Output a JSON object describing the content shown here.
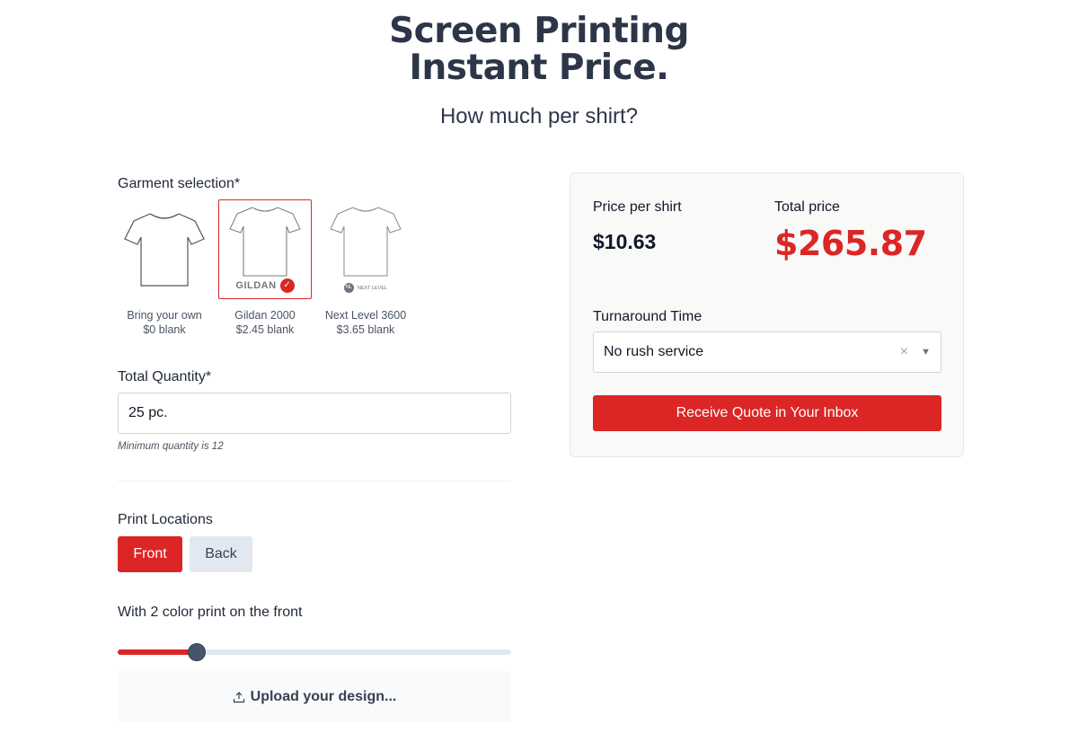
{
  "hero": {
    "title_line1": "Screen Printing",
    "title_line2": "Instant Price.",
    "subtitle": "How much per shirt?"
  },
  "garment": {
    "label": "Garment selection*",
    "options": [
      {
        "name": "Bring your own",
        "price": "$0 blank",
        "brand": "",
        "selected": false
      },
      {
        "name": "Gildan 2000",
        "price": "$2.45 blank",
        "brand": "GILDAN",
        "selected": true
      },
      {
        "name": "Next Level 3600",
        "price": "$3.65 blank",
        "brand": "NEXT LEVEL",
        "badge": "NL",
        "selected": false
      }
    ]
  },
  "quantity": {
    "label": "Total Quantity*",
    "value": "25 pc.",
    "hint": "Minimum quantity is 12"
  },
  "locations": {
    "label": "Print Locations",
    "front_label": "Front",
    "back_label": "Back",
    "active": "Front"
  },
  "colors": {
    "label": "With 2 color print on the front",
    "count": 2,
    "min": 1,
    "max": 10
  },
  "upload": {
    "label": "Upload your design...",
    "icon": "upload-icon"
  },
  "price": {
    "per_shirt_label": "Price per shirt",
    "per_shirt_value": "$10.63",
    "total_label": "Total price",
    "total_value": "$265.87"
  },
  "turnaround": {
    "label": "Turnaround Time",
    "selected": "No rush service"
  },
  "cta": {
    "label": "Receive Quote in Your Inbox"
  },
  "theme": {
    "accent": "#dc2626",
    "heading": "#2d3648",
    "panel_bg": "#f9f9f8"
  }
}
